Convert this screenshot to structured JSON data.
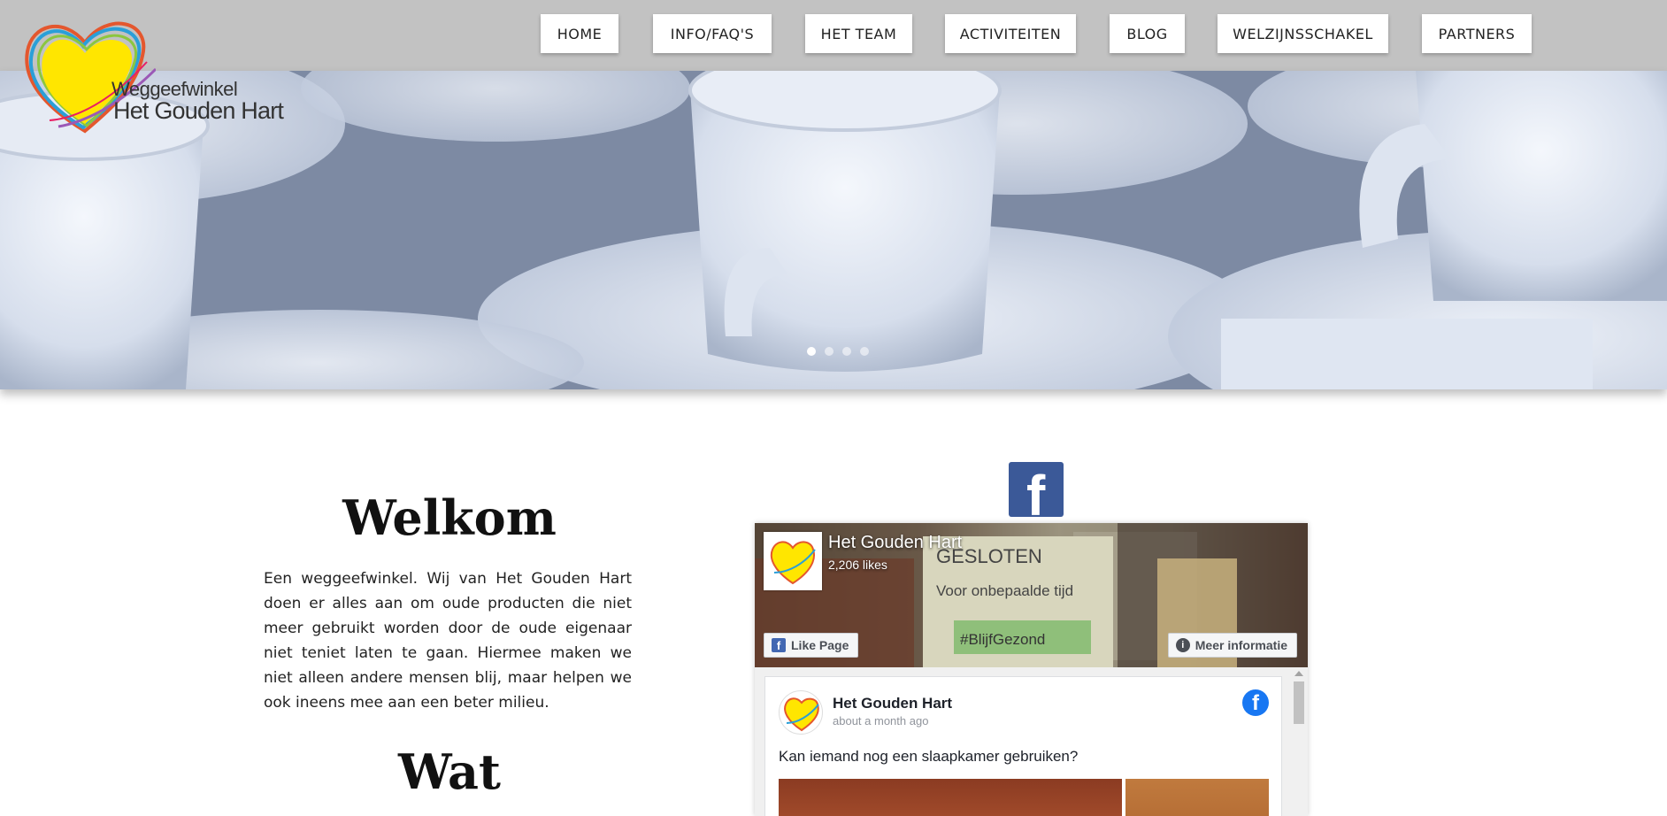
{
  "nav": {
    "items": [
      {
        "label": "HOME"
      },
      {
        "label": "INFO/FAQ'S"
      },
      {
        "label": "HET TEAM"
      },
      {
        "label": "ACTIVITEITEN"
      },
      {
        "label": "BLOG"
      },
      {
        "label": "WELZIJNSSCHAKEL"
      },
      {
        "label": "PARTNERS"
      }
    ]
  },
  "logo": {
    "line1": "Weggeefwinkel",
    "line2": "Het Gouden Hart"
  },
  "hero": {
    "slide_count": 4,
    "active_slide": 1
  },
  "welkom": {
    "title": "Welkom",
    "text": "Een weggeefwinkel. Wij van Het Gouden Hart doen er alles aan om oude producten die niet meer gebruikt worden door de oude eigenaar niet teniet laten te gaan. Hiermee maken we niet alleen andere mensen blij, maar helpen we ook ineens mee aan een beter milieu."
  },
  "wat": {
    "title": "Wat"
  },
  "facebook": {
    "logo_glyph": "f",
    "page_name": "Het Gouden Hart",
    "likes": "2,206 likes",
    "like_button": "Like Page",
    "info_button": "Meer informatie",
    "cover_text": [
      "GESLOTEN",
      "Voor onbepaalde tijd",
      "#BlijfGezond"
    ],
    "post": {
      "author": "Het Gouden Hart",
      "time": "about a month ago",
      "text": "Kan iemand nog een slaapkamer gebruiken?"
    }
  },
  "colors": {
    "topbar": "#c2c2c2",
    "facebook_blue": "#3b5998",
    "logo_yellow": "#ffe600"
  }
}
